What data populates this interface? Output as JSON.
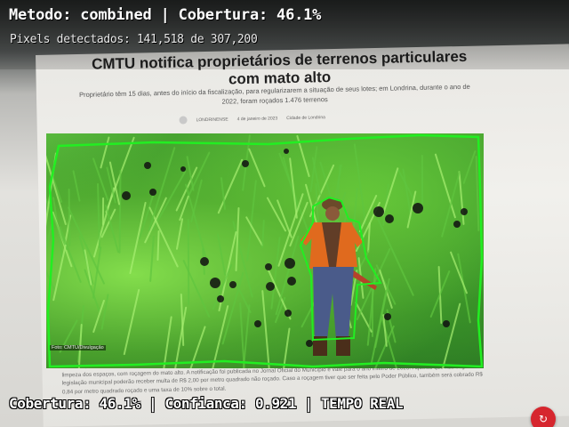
{
  "hud": {
    "title": "Metodo: combined | Cobertura: 46.1%",
    "pixels": "Pixels detectados: 141,518 de 307,200",
    "status": "Cobertura: 46.1% | Confianca: 0.921 | TEMPO REAL"
  },
  "detection": {
    "method": "combined",
    "coverage_percent": 46.1,
    "pixels_detected": 141518,
    "pixels_total": 307200,
    "confidence": 0.921,
    "mask_color": "#22ee22"
  },
  "article": {
    "headline": "CMTU notifica proprietários de terrenos particulares com mato alto",
    "subhead": "Proprietário têm 15 dias, antes do início da fiscalização, para regularizarem a situação de seus lotes; em Londrina, durante o ano de 2022, foram roçados 1.476 terrenos",
    "byline_author": "LONDRINENSE",
    "byline_date": "4 de janeiro de 2023",
    "byline_tags": "Cidade de Londrina",
    "photo_credit": "Foto: CMTU/Divulgação",
    "body": "Nesta terça-feira (3), a Companhia Municipal de Trânsito e Urbanização (CMTU) notificou os proprietários de terrenos particulares, para que realizem, em até 15 dias, a limpeza dos espaços, com roçagem do mato alto. A notificação foi publicada no Jornal Oficial do Município e vale para o ano inteiro de 2023. Aqueles que não seguirem a legislação municipal poderão receber multa de R$ 2,00 por metro quadrado não roçado. Caso a roçagem tiver que ser feita pelo Poder Público, também será cobrado R$ 0,84 por metro quadrado roçado e uma taxa de 10% sobre o total."
  },
  "icons": {
    "fab": "scroll-up-icon",
    "avatar": "author-avatar-icon"
  }
}
